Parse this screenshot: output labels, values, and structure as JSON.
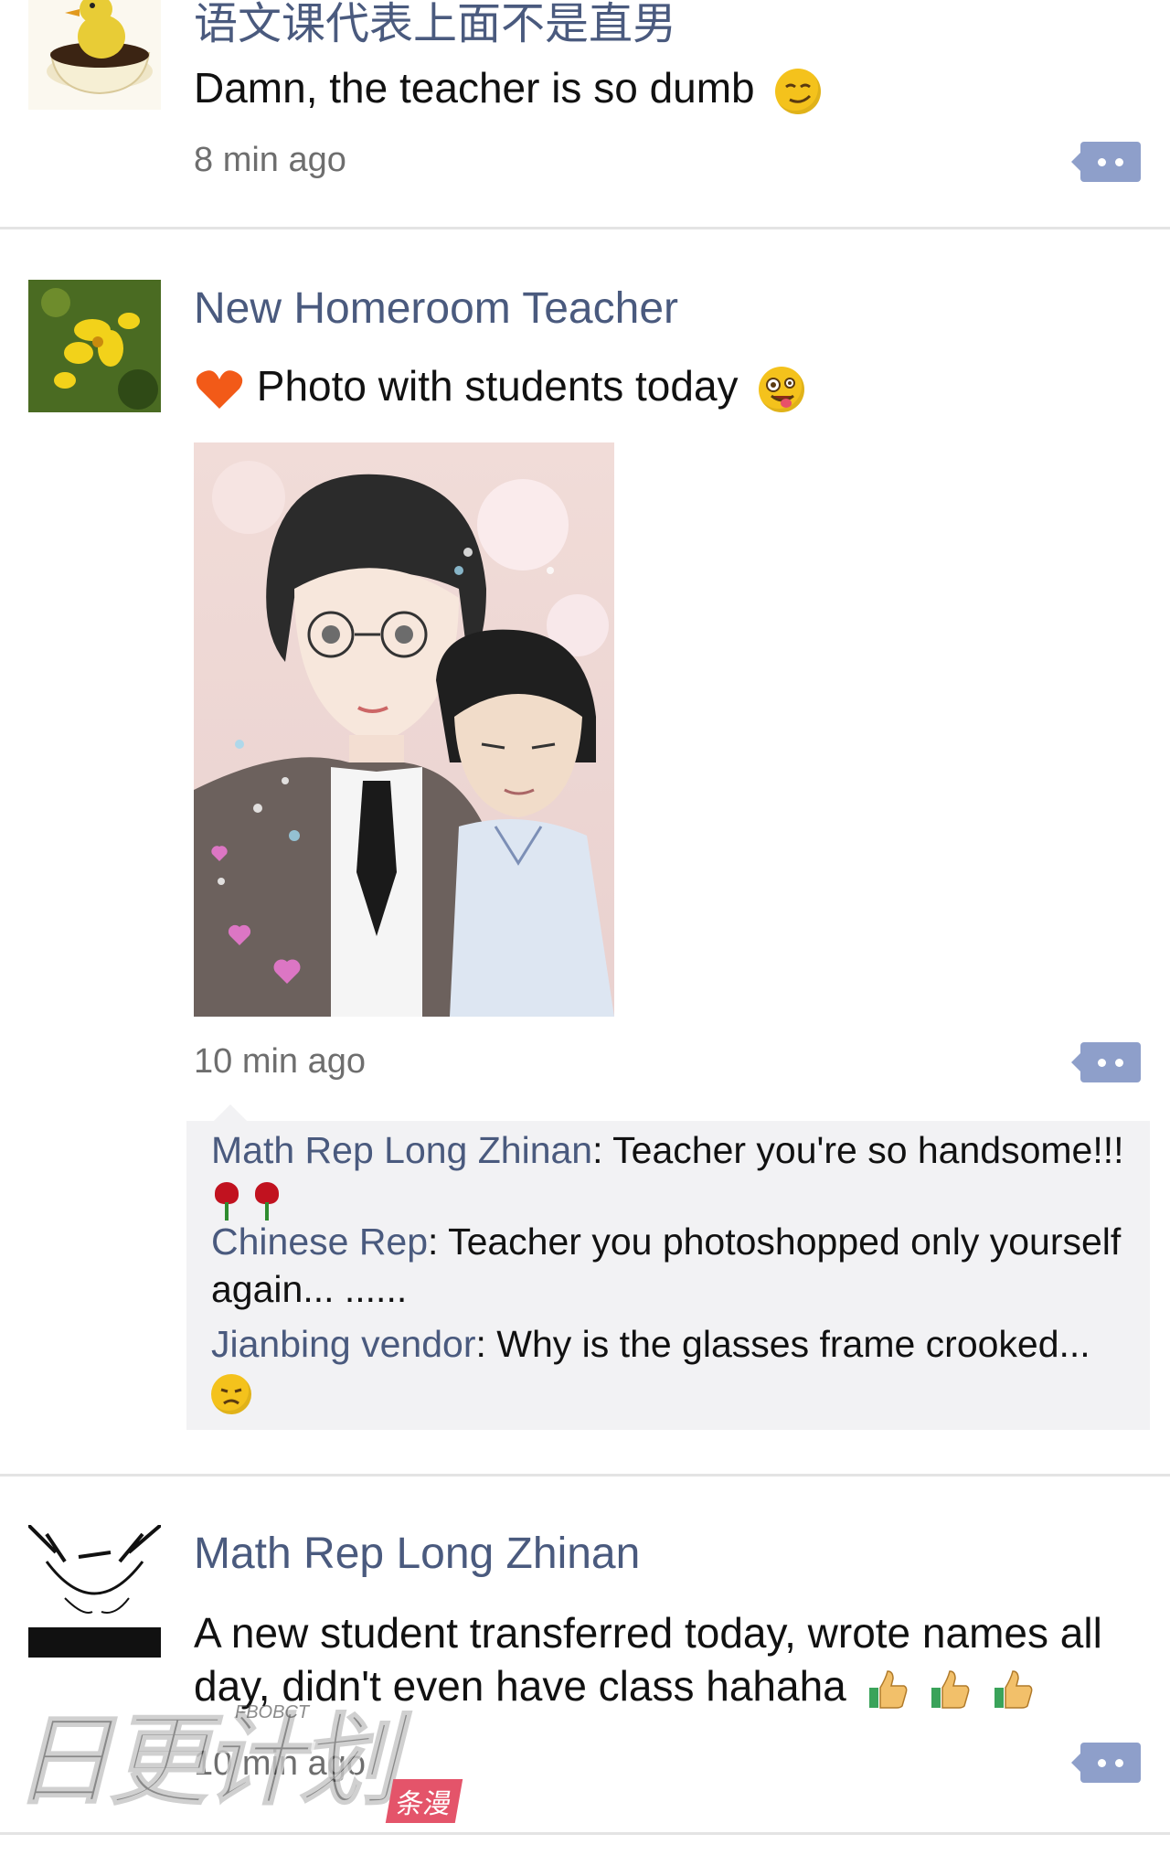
{
  "posts": [
    {
      "author": "语文课代表上面不是直男",
      "text": "Damn, the teacher is so dumb",
      "time": "8 min ago",
      "emoji": "smirk-face"
    },
    {
      "author": "New Homeroom Teacher",
      "text": "Photo with students today",
      "prefix_emoji": "orange-heart",
      "emoji": "zany-face",
      "time": "10 min ago",
      "comments": [
        {
          "author": "Math Rep Long Zhinan",
          "text": "Teacher you're so handsome!!!",
          "emoji": "rose"
        },
        {
          "author": "Chinese Rep",
          "text": "Teacher you photoshopped only yourself again... ......"
        },
        {
          "author": "Jianbing vendor",
          "text": "Why is the glasses frame crooked...",
          "emoji": "worried-face"
        }
      ]
    },
    {
      "author": "Math Rep Long Zhinan",
      "text_line1": "A new student transferred today, wrote names all",
      "text_line2": "day, didn't even have class hahaha",
      "emoji": "thumbs-up",
      "time": "10 min ago"
    }
  ],
  "watermark": {
    "text": "日更计划",
    "tag": "条漫",
    "small": "FBOBCT"
  },
  "colors": {
    "name_blue": "#4a5a7e",
    "button": "#8e9fca",
    "comment_bg": "#f2f2f4"
  }
}
